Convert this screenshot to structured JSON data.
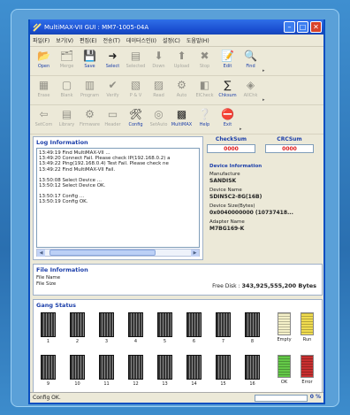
{
  "window": {
    "title": "MultiMAX-VII GUI : MM7-1005-04A"
  },
  "menu": [
    "파일(F)",
    "보기(V)",
    "편집(E)",
    "전송(T)",
    "데이터스인(I)",
    "설정(C)",
    "도움말(H)"
  ],
  "toolbar_rows": [
    [
      {
        "name": "open",
        "label": "Open",
        "icon": "📂",
        "enabled": true
      },
      {
        "name": "merge",
        "label": "Merge",
        "icon": "🗂",
        "enabled": false
      },
      {
        "name": "save",
        "label": "Save",
        "icon": "💾",
        "enabled": true
      },
      {
        "name": "select",
        "label": "Select",
        "icon": "➜",
        "enabled": true
      },
      {
        "name": "selected",
        "label": "Selected",
        "icon": "▤",
        "enabled": false
      },
      {
        "name": "down",
        "label": "Down",
        "icon": "⬇",
        "enabled": false
      },
      {
        "name": "upload",
        "label": "Upload",
        "icon": "⬆",
        "enabled": false
      },
      {
        "name": "stop",
        "label": "Stop",
        "icon": "✖",
        "enabled": false
      },
      {
        "name": "edit",
        "label": "Edit",
        "icon": "📝",
        "enabled": true
      },
      {
        "name": "find",
        "label": "Find",
        "icon": "🔍",
        "enabled": true
      }
    ],
    [
      {
        "name": "erase",
        "label": "Erase",
        "icon": "▦",
        "enabled": false
      },
      {
        "name": "blank",
        "label": "Blank",
        "icon": "▢",
        "enabled": false
      },
      {
        "name": "program",
        "label": "Program",
        "icon": "▥",
        "enabled": false
      },
      {
        "name": "verify",
        "label": "Verify",
        "icon": "✔",
        "enabled": false
      },
      {
        "name": "pv",
        "label": "P & V",
        "icon": "▧",
        "enabled": false
      },
      {
        "name": "read",
        "label": "Read",
        "icon": "▨",
        "enabled": false
      },
      {
        "name": "auto",
        "label": "Auto",
        "icon": "⚙",
        "enabled": false
      },
      {
        "name": "eicheck",
        "label": "EICheck",
        "icon": "◧",
        "enabled": false
      },
      {
        "name": "chksum",
        "label": "Chksum",
        "icon": "∑",
        "enabled": true
      },
      {
        "name": "abort",
        "label": "AllChk",
        "icon": "◈",
        "enabled": false
      }
    ],
    [
      {
        "name": "setcom",
        "label": "SetCom",
        "icon": "⇦",
        "enabled": false
      },
      {
        "name": "library",
        "label": "Library",
        "icon": "▤",
        "enabled": false
      },
      {
        "name": "firmware",
        "label": "Firmware",
        "icon": "⚙",
        "enabled": false
      },
      {
        "name": "header",
        "label": "Header",
        "icon": "▭",
        "enabled": false
      },
      {
        "name": "config",
        "label": "Config",
        "icon": "🛠",
        "enabled": true
      },
      {
        "name": "setauto",
        "label": "SetAuto",
        "icon": "◎",
        "enabled": false
      },
      {
        "name": "multimax",
        "label": "MultiMAX",
        "icon": "▩",
        "enabled": true
      },
      {
        "name": "help",
        "label": "Help",
        "icon": "❔",
        "enabled": true
      },
      {
        "name": "exit",
        "label": "Exit",
        "icon": "⛔",
        "enabled": true
      }
    ]
  ],
  "log": {
    "title": "Log Information",
    "lines": [
      "13:49:19 Find MultiMAX-VII ...",
      "13:49:20 Connect Fail.  Please check IP(192.168.0.2) a",
      "13:49:22 Ping(192.168.0.4) Test Fail.  Please check ne",
      "13:49:22 Find MultiMAX-VII Fail.",
      "",
      "13:50:08 Select Device ...",
      "13:50:12 Select Device OK.",
      "",
      "13:50:17 Config ...",
      "13:50:19 Config OK."
    ]
  },
  "checksum": {
    "label": "CheckSum",
    "value": "0000"
  },
  "crcsum": {
    "label": "CRCSum",
    "value": "0000"
  },
  "device": {
    "title": "Device Information",
    "fields": [
      {
        "label": "Manufacture",
        "value": "SANDISK"
      },
      {
        "label": "Device Name",
        "value": "SDIN5C2-8G(16B)"
      },
      {
        "label": "Device Size(Bytes)",
        "value": "0x0040000000 (10737418..."
      },
      {
        "label": "Adapter Name",
        "value": "M7BG169-K"
      }
    ]
  },
  "file": {
    "title": "File Information",
    "name_label": "File Name",
    "size_label": "File Size",
    "free_label": "Free Disk :",
    "free_value": "343,925,555,200 Bytes"
  },
  "gang": {
    "title": "Gang Status",
    "sockets_row1": [
      "1",
      "2",
      "3",
      "4",
      "5",
      "6",
      "7",
      "8"
    ],
    "sockets_row2": [
      "9",
      "10",
      "11",
      "12",
      "13",
      "14",
      "15",
      "16"
    ],
    "legend": [
      {
        "label": "Empty",
        "color": "#f4f0c8"
      },
      {
        "label": "Run",
        "color": "#f0dc50"
      },
      {
        "label": "OK",
        "color": "#64c848"
      },
      {
        "label": "Error",
        "color": "#c83030"
      }
    ]
  },
  "status": {
    "text": "Config OK.",
    "progress_pct": "0 %",
    "progress": 0
  },
  "colors": {
    "accent": "#1c3faa",
    "title_bar": "#1a4ed0",
    "error": "#e01818"
  }
}
